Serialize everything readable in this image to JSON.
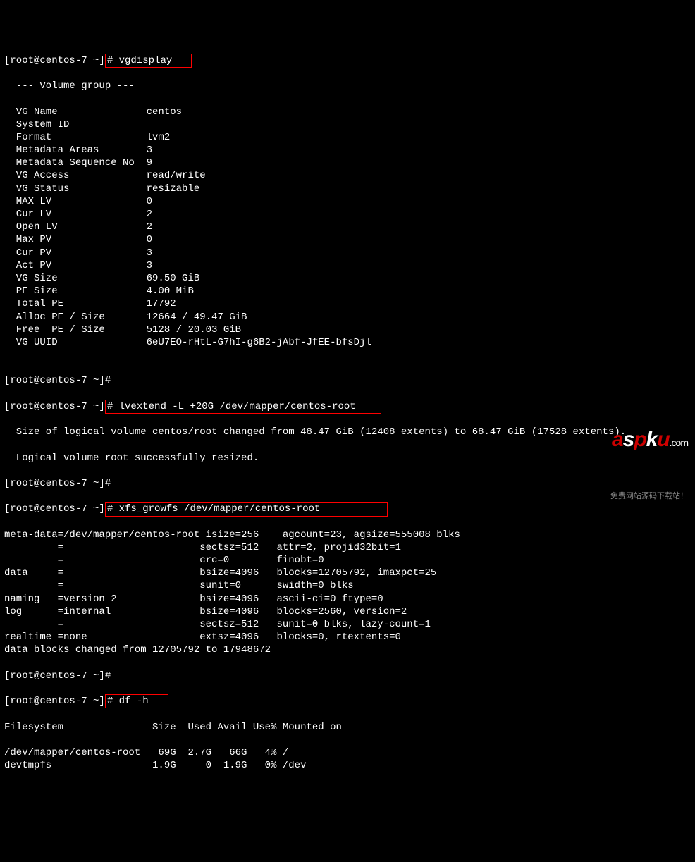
{
  "prompt_prefix": "[root@centos-7 ~]",
  "cmd1": "# vgdisplay",
  "vg_header": "  --- Volume group ---",
  "vg_rows": [
    {
      "label": "  VG Name",
      "value": "centos"
    },
    {
      "label": "  System ID",
      "value": ""
    },
    {
      "label": "  Format",
      "value": "lvm2"
    },
    {
      "label": "  Metadata Areas",
      "value": "3"
    },
    {
      "label": "  Metadata Sequence No",
      "value": "9"
    },
    {
      "label": "  VG Access",
      "value": "read/write"
    },
    {
      "label": "  VG Status",
      "value": "resizable"
    },
    {
      "label": "  MAX LV",
      "value": "0"
    },
    {
      "label": "  Cur LV",
      "value": "2"
    },
    {
      "label": "  Open LV",
      "value": "2"
    },
    {
      "label": "  Max PV",
      "value": "0"
    },
    {
      "label": "  Cur PV",
      "value": "3"
    },
    {
      "label": "  Act PV",
      "value": "3"
    },
    {
      "label": "  VG Size",
      "value": "69.50 GiB"
    },
    {
      "label": "  PE Size",
      "value": "4.00 MiB"
    },
    {
      "label": "  Total PE",
      "value": "17792"
    },
    {
      "label": "  Alloc PE / Size",
      "value": "12664 / 49.47 GiB"
    },
    {
      "label": "  Free  PE / Size",
      "value": "5128 / 20.03 GiB"
    },
    {
      "label": "  VG UUID",
      "value": "6eU7EO-rHtL-G7hI-g6B2-jAbf-JfEE-bfsDjl"
    }
  ],
  "blank": "",
  "prompt_hash": "#",
  "cmd2": "# lvextend -L +20G /dev/mapper/centos-root",
  "lvext_out1": "  Size of logical volume centos/root changed from 48.47 GiB (12408 extents) to 68.47 GiB (17528 extents).",
  "lvext_out2": "  Logical volume root successfully resized.",
  "cmd3": "# xfs_growfs /dev/mapper/centos-root",
  "xfs_lines": [
    "meta-data=/dev/mapper/centos-root isize=256    agcount=23, agsize=555008 blks",
    "         =                       sectsz=512   attr=2, projid32bit=1",
    "         =                       crc=0        finobt=0",
    "data     =                       bsize=4096   blocks=12705792, imaxpct=25",
    "         =                       sunit=0      swidth=0 blks",
    "naming   =version 2              bsize=4096   ascii-ci=0 ftype=0",
    "log      =internal               bsize=4096   blocks=2560, version=2",
    "         =                       sectsz=512   sunit=0 blks, lazy-count=1",
    "realtime =none                   extsz=4096   blocks=0, rtextents=0",
    "data blocks changed from 12705792 to 17948672"
  ],
  "cmd4": "# df -h",
  "df_header": "Filesystem               Size  Used Avail Use% Mounted on",
  "df_rows": [
    "/dev/mapper/centos-root   69G  2.7G   66G   4% /",
    "devtmpfs                 1.9G     0  1.9G   0% /dev"
  ],
  "logo": {
    "subtitle": "免费网站源码下载站！"
  }
}
